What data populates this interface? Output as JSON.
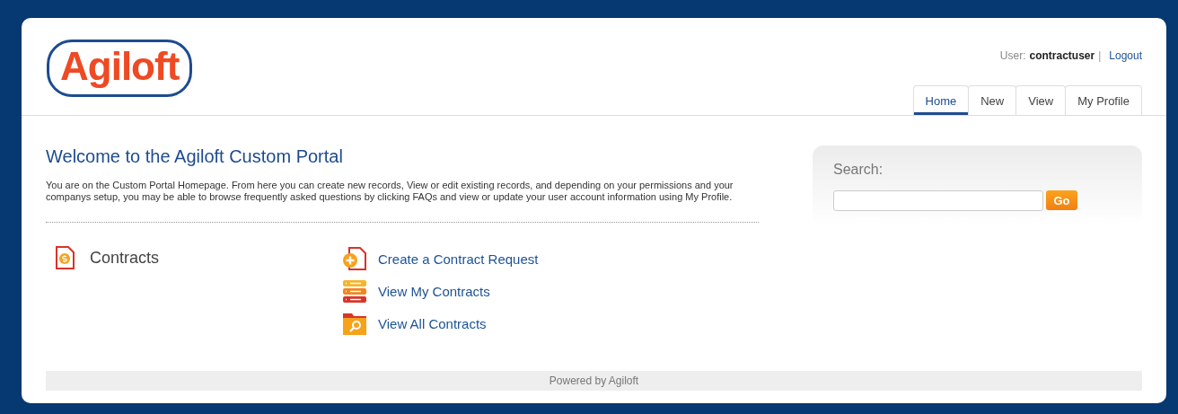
{
  "logo": {
    "text": "Agiloft"
  },
  "user_bar": {
    "label": "User:",
    "username": "contractuser",
    "separator": "|",
    "logout": "Logout"
  },
  "tabs": [
    {
      "label": "Home",
      "selected": true
    },
    {
      "label": "New",
      "selected": false
    },
    {
      "label": "View",
      "selected": false
    },
    {
      "label": "My Profile",
      "selected": false
    }
  ],
  "welcome": {
    "title": "Welcome to the Agiloft Custom Portal",
    "text": "You are on the Custom Portal Homepage. From here you can create new records, View or edit existing records, and depending on your permissions and your companys setup, you may be able to browse frequently asked questions by clicking FAQs and view or update your user account information using My Profile."
  },
  "search": {
    "label": "Search:",
    "button": "Go"
  },
  "section": {
    "title": "Contracts",
    "links": [
      {
        "kind": "create",
        "label": "Create a Contract Request"
      },
      {
        "kind": "list",
        "label": "View My Contracts"
      },
      {
        "kind": "folder",
        "label": "View All Contracts"
      }
    ]
  },
  "footer": "Powered by Agiloft"
}
